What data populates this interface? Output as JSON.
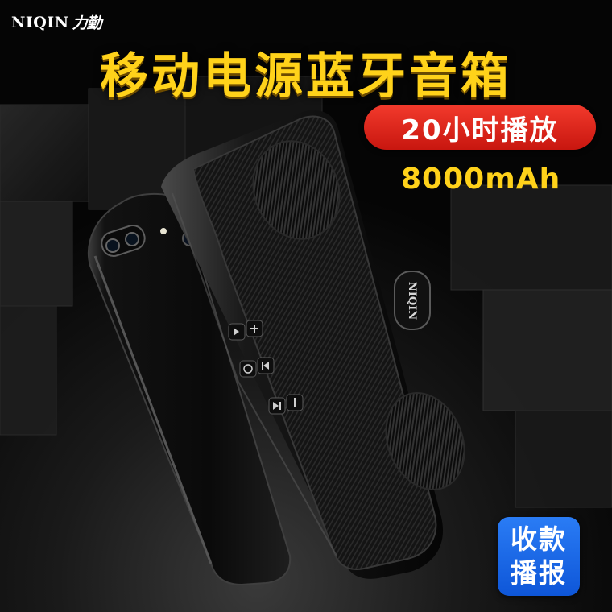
{
  "brand": {
    "latin": "NIQIN",
    "chinese": "力勤"
  },
  "headline": "移动电源蓝牙音箱",
  "playtime_badge": "20小时播放",
  "capacity": "8000mAh",
  "speaker_logo": "NIQIN",
  "payment_badge": {
    "line1": "收款",
    "line2": "播报"
  },
  "button_icons": [
    "play-pause-icon",
    "volume-up-icon",
    "mode-icon",
    "previous-track-icon",
    "next-track-icon",
    "volume-down-icon"
  ],
  "colors": {
    "headline": "#ffd21a",
    "pill": "#d81e17",
    "badge": "#1763e6",
    "background": "#0c0c0c"
  }
}
